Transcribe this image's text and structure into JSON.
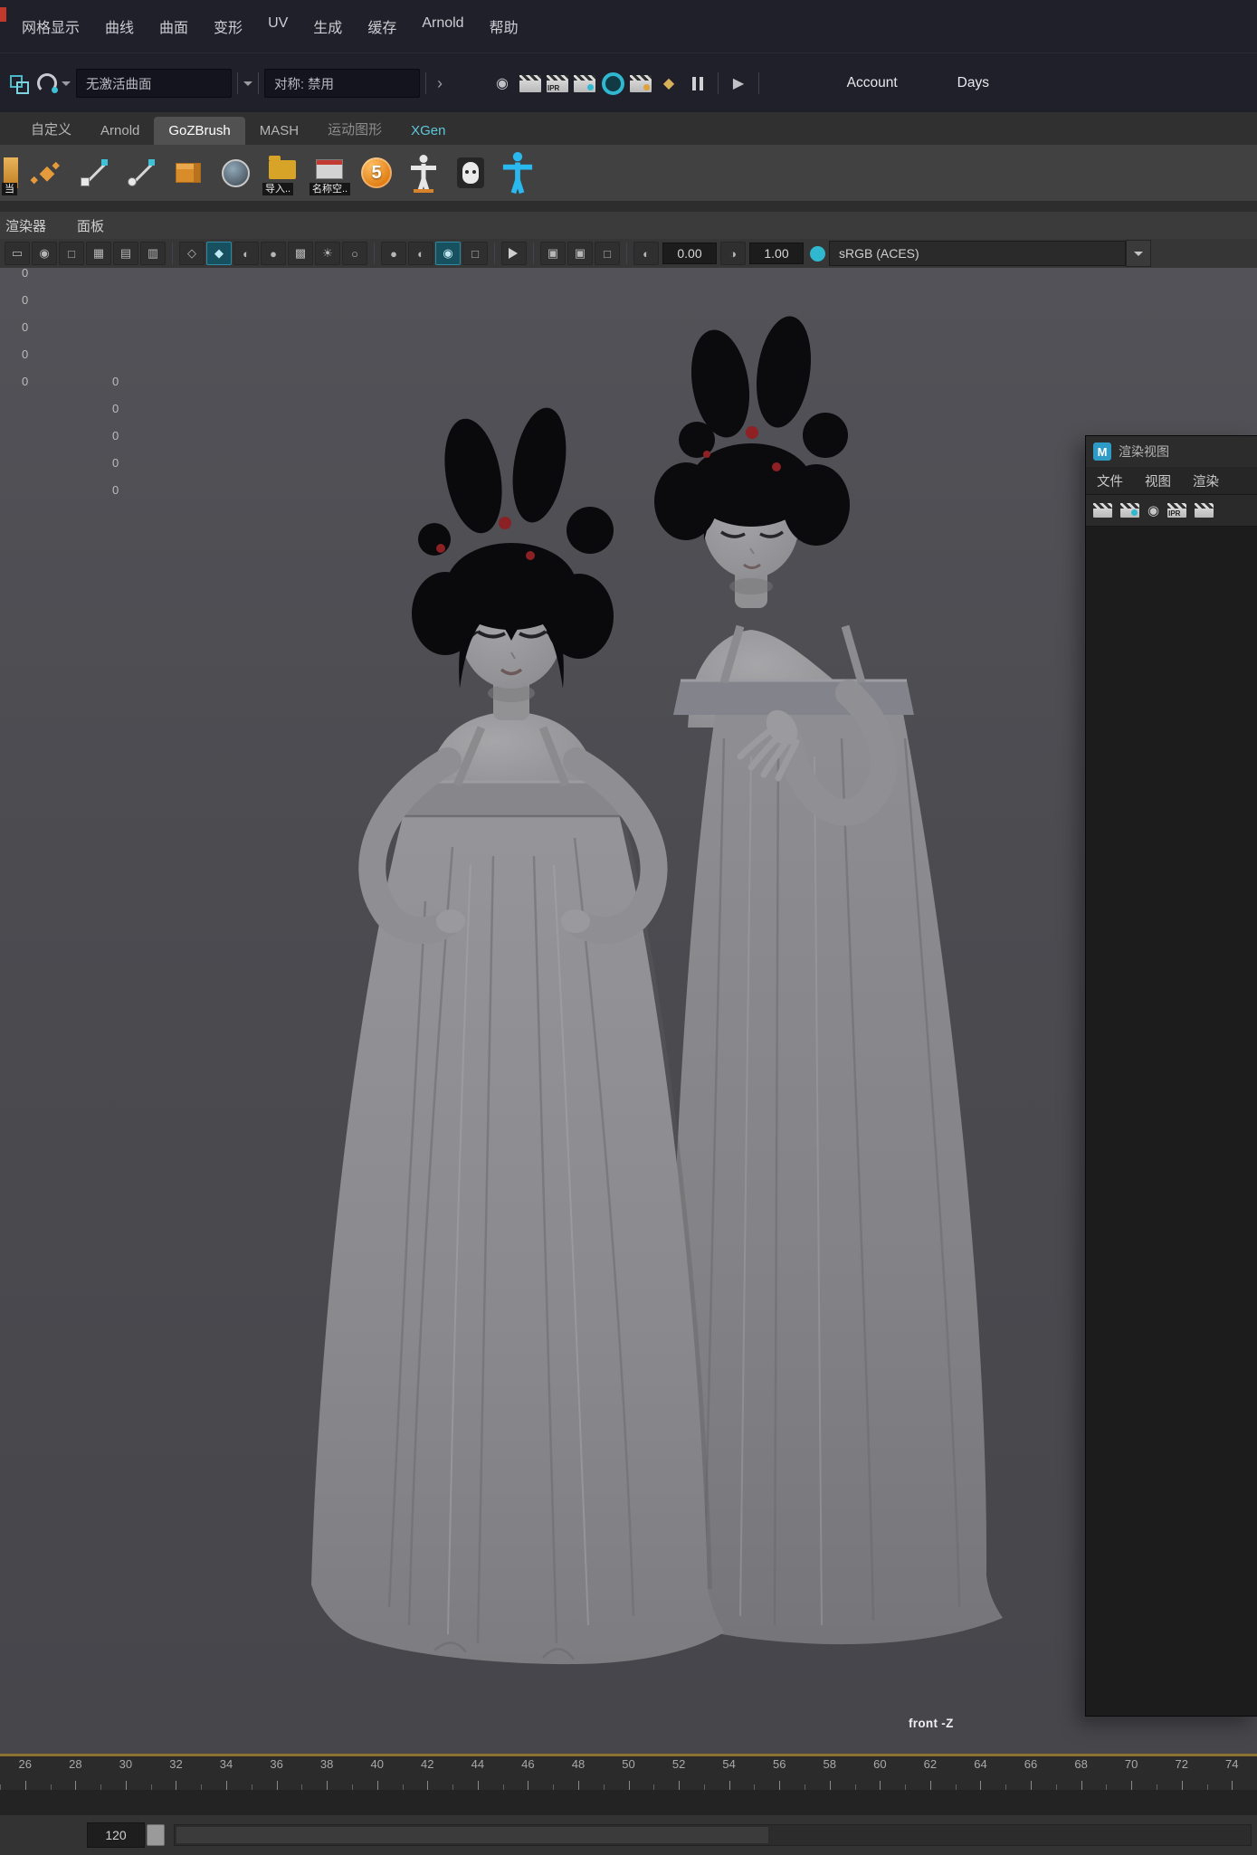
{
  "menubar": {
    "items": [
      "网格显示",
      "曲线",
      "曲面",
      "变形",
      "UV",
      "生成",
      "缓存",
      "Arnold",
      "帮助"
    ]
  },
  "statusline": {
    "no_active_surface": "无激活曲面",
    "symmetry": "对称: 禁用",
    "ipr_label": "IPR",
    "account_label": "Account",
    "days_label": "Days"
  },
  "shelf_tabs": {
    "items": [
      "自定义",
      "Arnold",
      "GoZBrush",
      "MASH",
      "运动图形",
      "XGen"
    ],
    "active": "GoZBrush"
  },
  "shelf": {
    "partial_label": "当",
    "import_label": "导入..",
    "namespace_label": "名称空..",
    "badge_five": "5"
  },
  "panel_menus": {
    "items": [
      "渲染器",
      "面板"
    ]
  },
  "viewport_toolbar": {
    "exposure": "0.00",
    "gamma": "1.00",
    "colorspace": "sRGB (ACES)"
  },
  "hud": {
    "col1": [
      "0",
      "0",
      "0",
      "0",
      "0"
    ],
    "col2": [
      "0",
      "0",
      "0",
      "0",
      "0"
    ]
  },
  "viewport": {
    "camera_label": "front -Z"
  },
  "render_view": {
    "title": "渲染视图",
    "app_badge": "M",
    "menus": [
      "文件",
      "视图",
      "渲染"
    ],
    "ipr_label": "IPR"
  },
  "timeline": {
    "ticks": [
      "26",
      "28",
      "30",
      "32",
      "34",
      "36",
      "38",
      "40",
      "42",
      "44",
      "46",
      "48",
      "50",
      "52",
      "54",
      "56",
      "58",
      "60",
      "62",
      "64",
      "66",
      "68",
      "70",
      "72",
      "74"
    ]
  },
  "range_slider": {
    "end_frame": "120"
  },
  "icons": {
    "eye": "◉",
    "play": "▶",
    "diamond": "◆",
    "rect": "▭",
    "square": "□",
    "grid": "▦",
    "film_gate": "▤",
    "text_gate": "▥",
    "wire_cube": "◇",
    "shaded_cube": "◆",
    "half_shade": "◐",
    "dark_sphere": "●",
    "checker": "▩",
    "light": "☀",
    "dim_light": "○",
    "gamma": "◑",
    "pane": "▣",
    "camera": "◉"
  },
  "colors": {
    "accent_teal": "#2fb8cf",
    "xgen_teal": "#5fc9da",
    "badge_orange": "#e07b10",
    "cache_line": "#8a7430"
  }
}
